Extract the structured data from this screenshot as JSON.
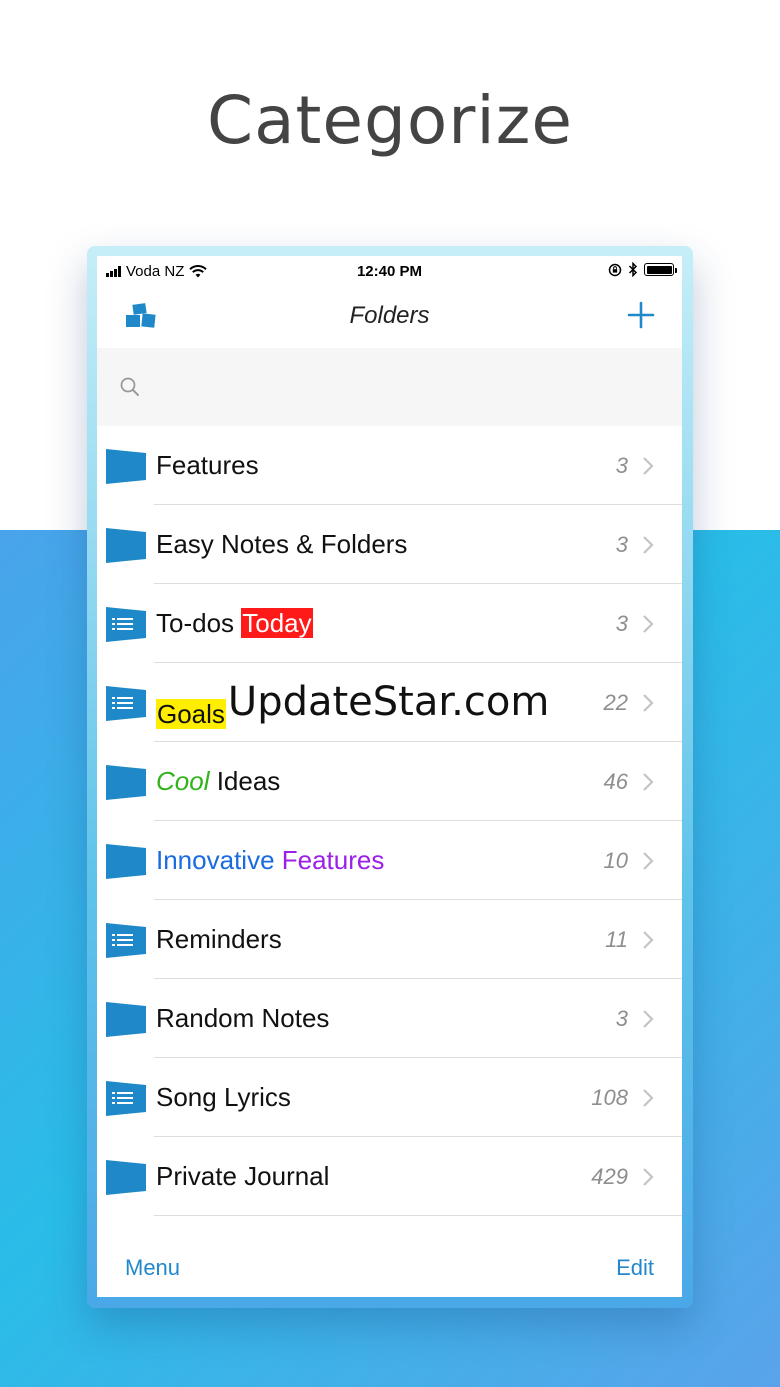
{
  "headline": "Categorize",
  "status_bar": {
    "carrier": "Voda NZ",
    "time": "12:40 PM"
  },
  "nav": {
    "title": "Folders",
    "left_icon": "folders-stack-icon",
    "right_icon": "plus-icon"
  },
  "search": {
    "placeholder": "",
    "icon": "search-icon"
  },
  "folders": [
    {
      "label": "Features",
      "count": "3",
      "icon": "folder-icon"
    },
    {
      "label": "Easy Notes & Folders",
      "count": "3",
      "icon": "folder-icon"
    },
    {
      "label_plain": "To-dos ",
      "label_highlight": "Today",
      "count": "3",
      "icon": "checklist-folder-icon"
    },
    {
      "label_highlight": "Goals",
      "watermark": "UpdateStar.com",
      "count": "22",
      "icon": "checklist-folder-icon"
    },
    {
      "label_colored": "Cool",
      "label_plain": " Ideas",
      "count": "46",
      "icon": "folder-icon"
    },
    {
      "label_blue": "Innovative",
      "label_purple": " Features",
      "count": "10",
      "icon": "folder-icon"
    },
    {
      "label": "Reminders",
      "count": "11",
      "icon": "checklist-folder-icon"
    },
    {
      "label": "Random Notes",
      "count": "3",
      "icon": "folder-icon"
    },
    {
      "label": "Song Lyrics",
      "count": "108",
      "icon": "checklist-folder-icon"
    },
    {
      "label": "Private Journal",
      "count": "429",
      "icon": "folder-icon"
    }
  ],
  "toolbar": {
    "menu_label": "Menu",
    "edit_label": "Edit"
  },
  "colors": {
    "accent": "#2288cc",
    "folder": "#1e88c8",
    "highlight_red": "#ff1a1a",
    "highlight_yellow": "#ffee00",
    "green_text": "#33b31a",
    "blue_text": "#1a6be0",
    "purple_text": "#9b1fe8"
  }
}
